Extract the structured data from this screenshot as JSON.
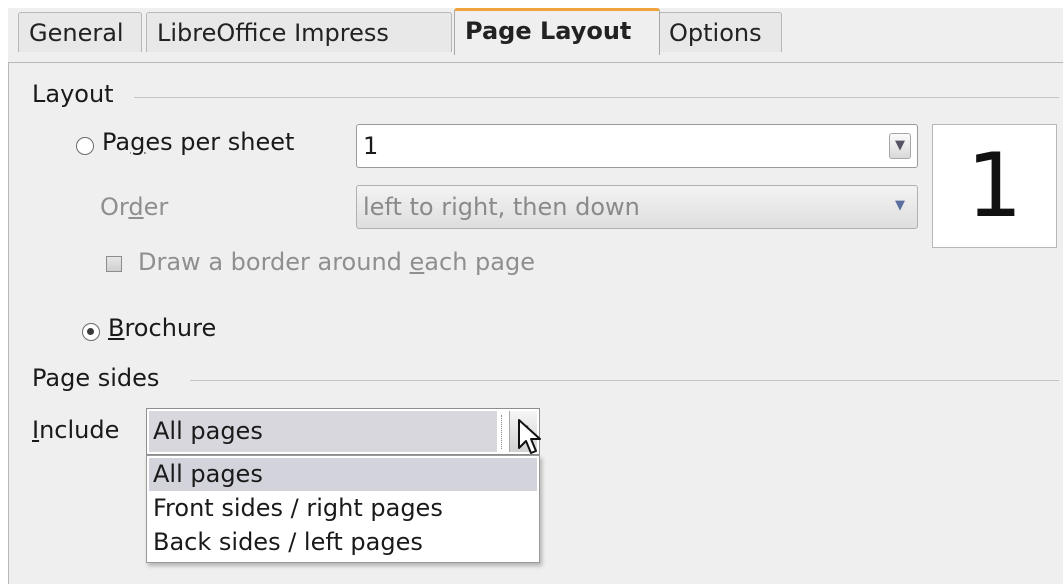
{
  "tabs": [
    {
      "label": "General"
    },
    {
      "label": "LibreOffice Impress"
    },
    {
      "label": "Page Layout",
      "active": true
    },
    {
      "label": "Options"
    }
  ],
  "layout": {
    "section_title": "Layout",
    "pages_per_sheet_label_pre": "Pa",
    "pages_per_sheet_label_mnemonic": "g",
    "pages_per_sheet_label_post": "es per sheet",
    "pages_per_sheet_value": "1",
    "order_label_pre": "Or",
    "order_label_mnemonic": "d",
    "order_label_post": "er",
    "order_value": "left to right, then down",
    "border_checkbox_pre": "Draw a border around ",
    "border_checkbox_mnemonic": "e",
    "border_checkbox_post": "ach page",
    "preview_number": "1",
    "brochure_label_mnemonic": "B",
    "brochure_label_post": "rochure",
    "brochure_selected": true,
    "pages_per_sheet_selected": false
  },
  "page_sides": {
    "section_title": "Page sides",
    "include_label_mnemonic": "I",
    "include_label_post": "nclude",
    "include_value": "All pages",
    "options": [
      "All pages",
      "Front sides / right pages",
      "Back sides / left pages"
    ],
    "selected_index": 0
  },
  "colors": {
    "active_tab_accent": "#f0a23c",
    "dialog_bg": "#efefef",
    "selection_bg": "#d3d3db"
  }
}
